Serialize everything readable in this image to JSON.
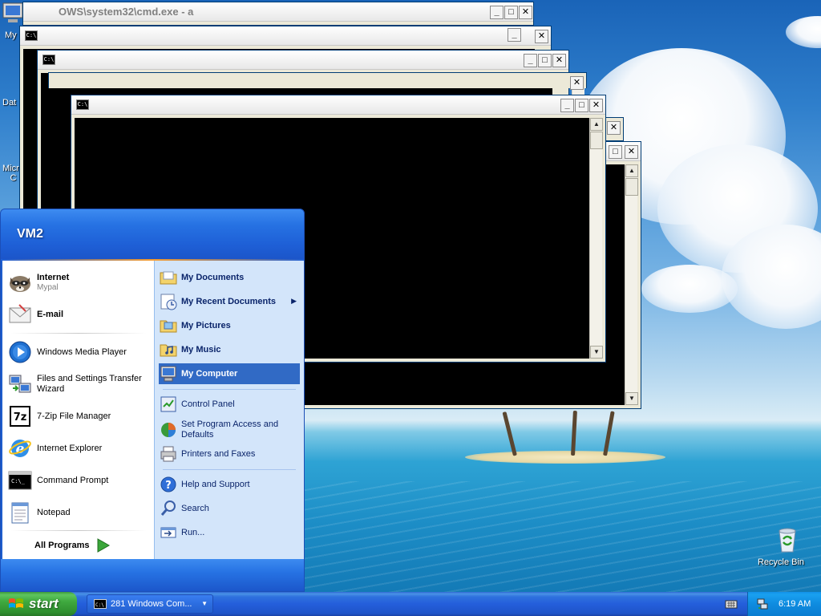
{
  "desktop": {
    "icons": [
      {
        "label": "My",
        "name": "my-computer-desktop-icon"
      },
      {
        "label": "Dat",
        "name": "data-desktop-icon"
      },
      {
        "label": "Micro\nC",
        "name": "microsoft-desktop-icon"
      }
    ],
    "recycle_bin": "Recycle Bin"
  },
  "windows": {
    "back_title": "OWS\\system32\\cmd.exe - a",
    "icon_glyph": "C:\\"
  },
  "start_menu": {
    "user": "VM2",
    "left": {
      "internet": {
        "label": "Internet",
        "sub": "Mypal"
      },
      "email": {
        "label": "E-mail"
      },
      "items": [
        "Windows Media Player",
        "Files and Settings Transfer Wizard",
        "7-Zip File Manager",
        "Internet Explorer",
        "Command Prompt",
        "Notepad"
      ],
      "all_programs": "All Programs"
    },
    "right": {
      "items": [
        "My Documents",
        "My Recent Documents",
        "My Pictures",
        "My Music",
        "My Computer",
        "Control Panel",
        "Set Program Access and Defaults",
        "Printers and Faxes",
        "Help and Support",
        "Search",
        "Run..."
      ]
    }
  },
  "taskbar": {
    "start": "start",
    "task_label": "281 Windows Com...",
    "clock": "6:19 AM"
  }
}
